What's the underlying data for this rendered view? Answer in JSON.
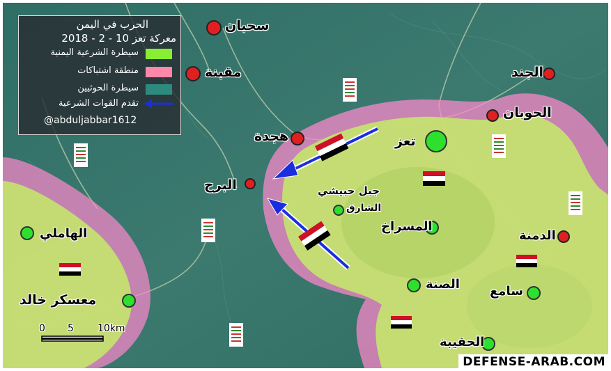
{
  "legend": {
    "title": "الحرب في اليمن",
    "subtitle": "معركة تعز 10 - 2 - 2018",
    "items": [
      {
        "label": "سيطرة الشرعية اليمنية",
        "color": "#88ee33"
      },
      {
        "label": "منطقة اشتباكات",
        "color": "#ff88aa"
      },
      {
        "label": "سيطرة الحوثيين",
        "color": "#2e8a7e"
      },
      {
        "label": "تقدم القوات الشرعية",
        "color": "#1a2ee0"
      }
    ],
    "handle": "@abduljabbar1612"
  },
  "places": {
    "sahban": "سحبان",
    "maqbana": "مقبنة",
    "hajda": "هجدة",
    "burh": "البرح",
    "hamli": "الهاملي",
    "muaskar": "معسكر خالد",
    "janad": "الجند",
    "hawban": "الحوبان",
    "taiz": "تعز",
    "habashi": "جبل حبيشي",
    "shariq": "الشارق",
    "masrakh": "المسراخ",
    "dimna": "الدمنة",
    "sina": "الصنة",
    "same": "سامع",
    "haqiba": "الحقيبة"
  },
  "scale": {
    "zero": "0",
    "five": "5",
    "ten": "10km"
  },
  "watermark": "DEFENSE-ARAB.COM"
}
